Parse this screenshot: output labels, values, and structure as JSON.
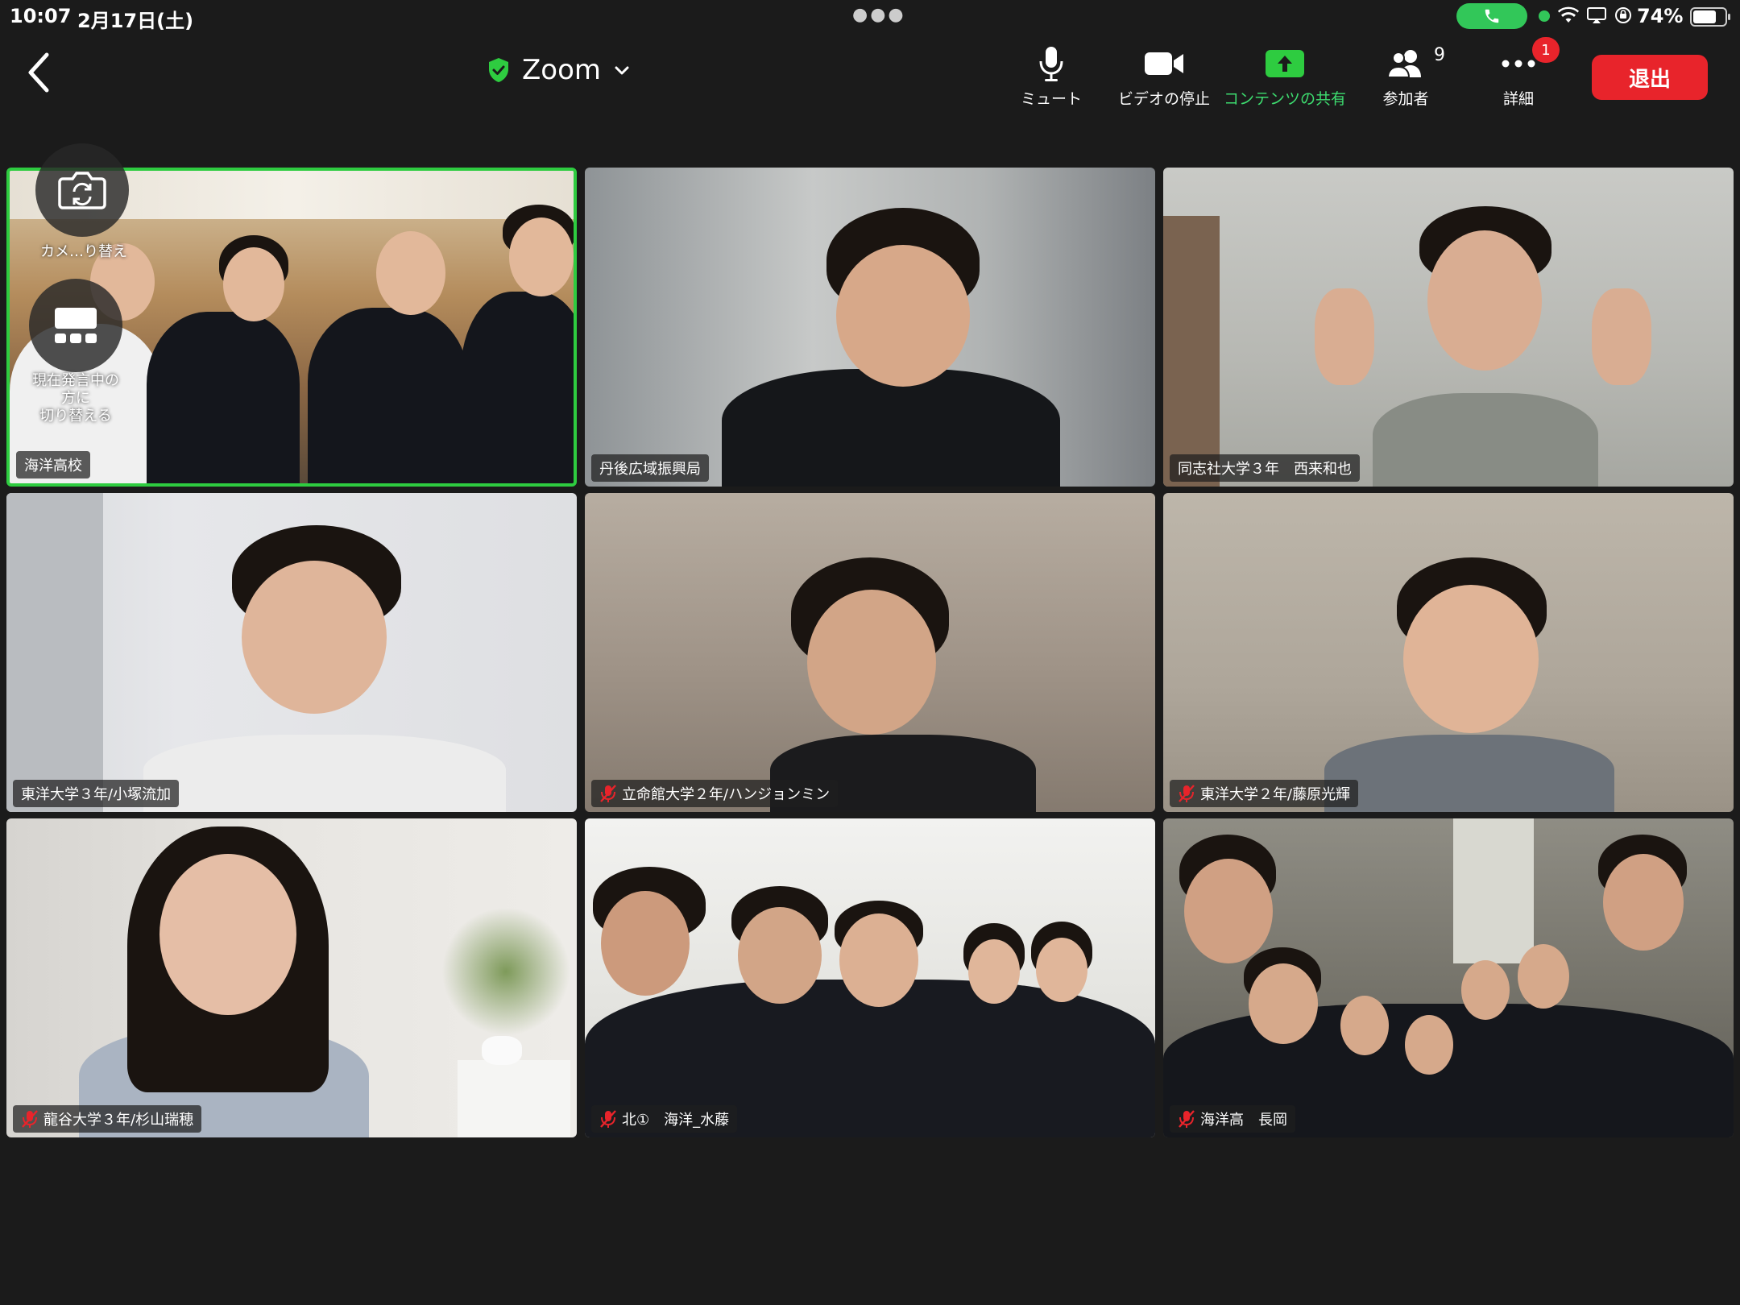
{
  "status_bar": {
    "time": "10:07",
    "date": "2月17日(土)",
    "battery": "74%",
    "battery_level": 0.74
  },
  "toolbar": {
    "title": "Zoom",
    "mute_label": "ミュート",
    "video_label": "ビデオの停止",
    "share_label": "コンテンツの共有",
    "participants_label": "参加者",
    "participants_count": "9",
    "more_label": "詳細",
    "more_badge": "1",
    "leave_label": "退出"
  },
  "overlay": {
    "switch_camera_label": "カメ…り替え",
    "speaker_view_label_1": "現在発言中の",
    "speaker_view_label_2": "方に",
    "speaker_view_label_3": "切り替える"
  },
  "tiles": [
    {
      "name": "海洋高校",
      "muted": false
    },
    {
      "name": "丹後広域振興局",
      "muted": false
    },
    {
      "name": "同志社大学３年　西来和也",
      "muted": false
    },
    {
      "name": "東洋大学３年/小塚流加",
      "muted": false
    },
    {
      "name": "立命館大学２年/ハンジョンミン",
      "muted": true
    },
    {
      "name": "東洋大学２年/藤原光輝",
      "muted": true
    },
    {
      "name": "龍谷大学３年/杉山瑞穂",
      "muted": true
    },
    {
      "name": "北①　海洋_水藤",
      "muted": true
    },
    {
      "name": "海洋高　長岡",
      "muted": true
    }
  ],
  "colors": {
    "active_speaker": "#2ecc40",
    "leave": "#e8242b",
    "share": "#3ddc6f"
  }
}
